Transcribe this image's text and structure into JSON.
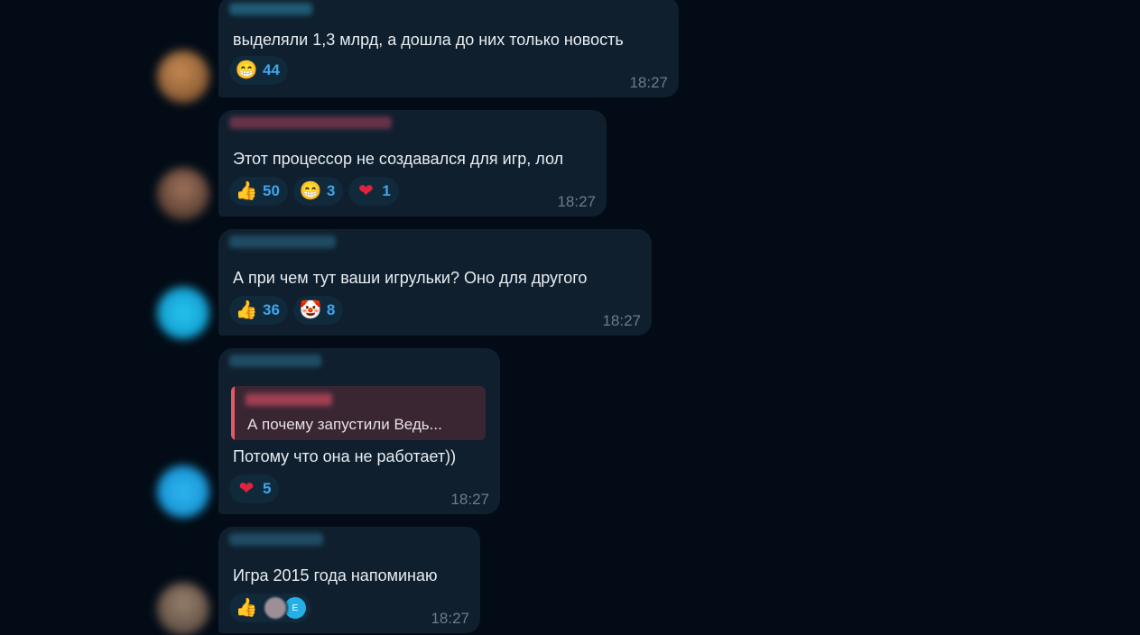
{
  "messages": [
    {
      "text": "выделяли 1,3 млрд, а дошла до них только новость",
      "time": "18:27",
      "reactions": [
        {
          "emoji": "grinning-face",
          "glyph": "😁",
          "count": "44"
        }
      ]
    },
    {
      "text": "Этот процессор не создавался для игр, лол",
      "time": "18:27",
      "reactions": [
        {
          "emoji": "thumbs-up",
          "glyph": "👍",
          "count": "50"
        },
        {
          "emoji": "grinning-face",
          "glyph": "😁",
          "count": "3"
        },
        {
          "emoji": "red-heart",
          "glyph": "❤",
          "count": "1"
        }
      ]
    },
    {
      "text": "А при чем тут ваши игрульки? Оно для другого",
      "time": "18:27",
      "reactions": [
        {
          "emoji": "thumbs-up",
          "glyph": "👍",
          "count": "36"
        },
        {
          "emoji": "clown-face",
          "glyph": "🤡",
          "count": "8"
        }
      ]
    },
    {
      "reply_snippet": "А почему запустили Ведь...",
      "text": "Потому что она не работает))",
      "time": "18:27",
      "reactions": [
        {
          "emoji": "red-heart",
          "glyph": "❤",
          "count": "5"
        }
      ]
    },
    {
      "text": "Игра 2015 года напоминаю",
      "time": "18:27",
      "reactions": [
        {
          "emoji": "thumbs-up",
          "glyph": "👍",
          "reactor_initial": "E"
        }
      ]
    }
  ],
  "colors": {
    "background": "#030c16",
    "bubble": "#0f1f2e",
    "reaction_bg": "#10293b",
    "count": "#3ea6ec",
    "time": "#6a7d8d",
    "reply_accent": "#e05a63"
  }
}
